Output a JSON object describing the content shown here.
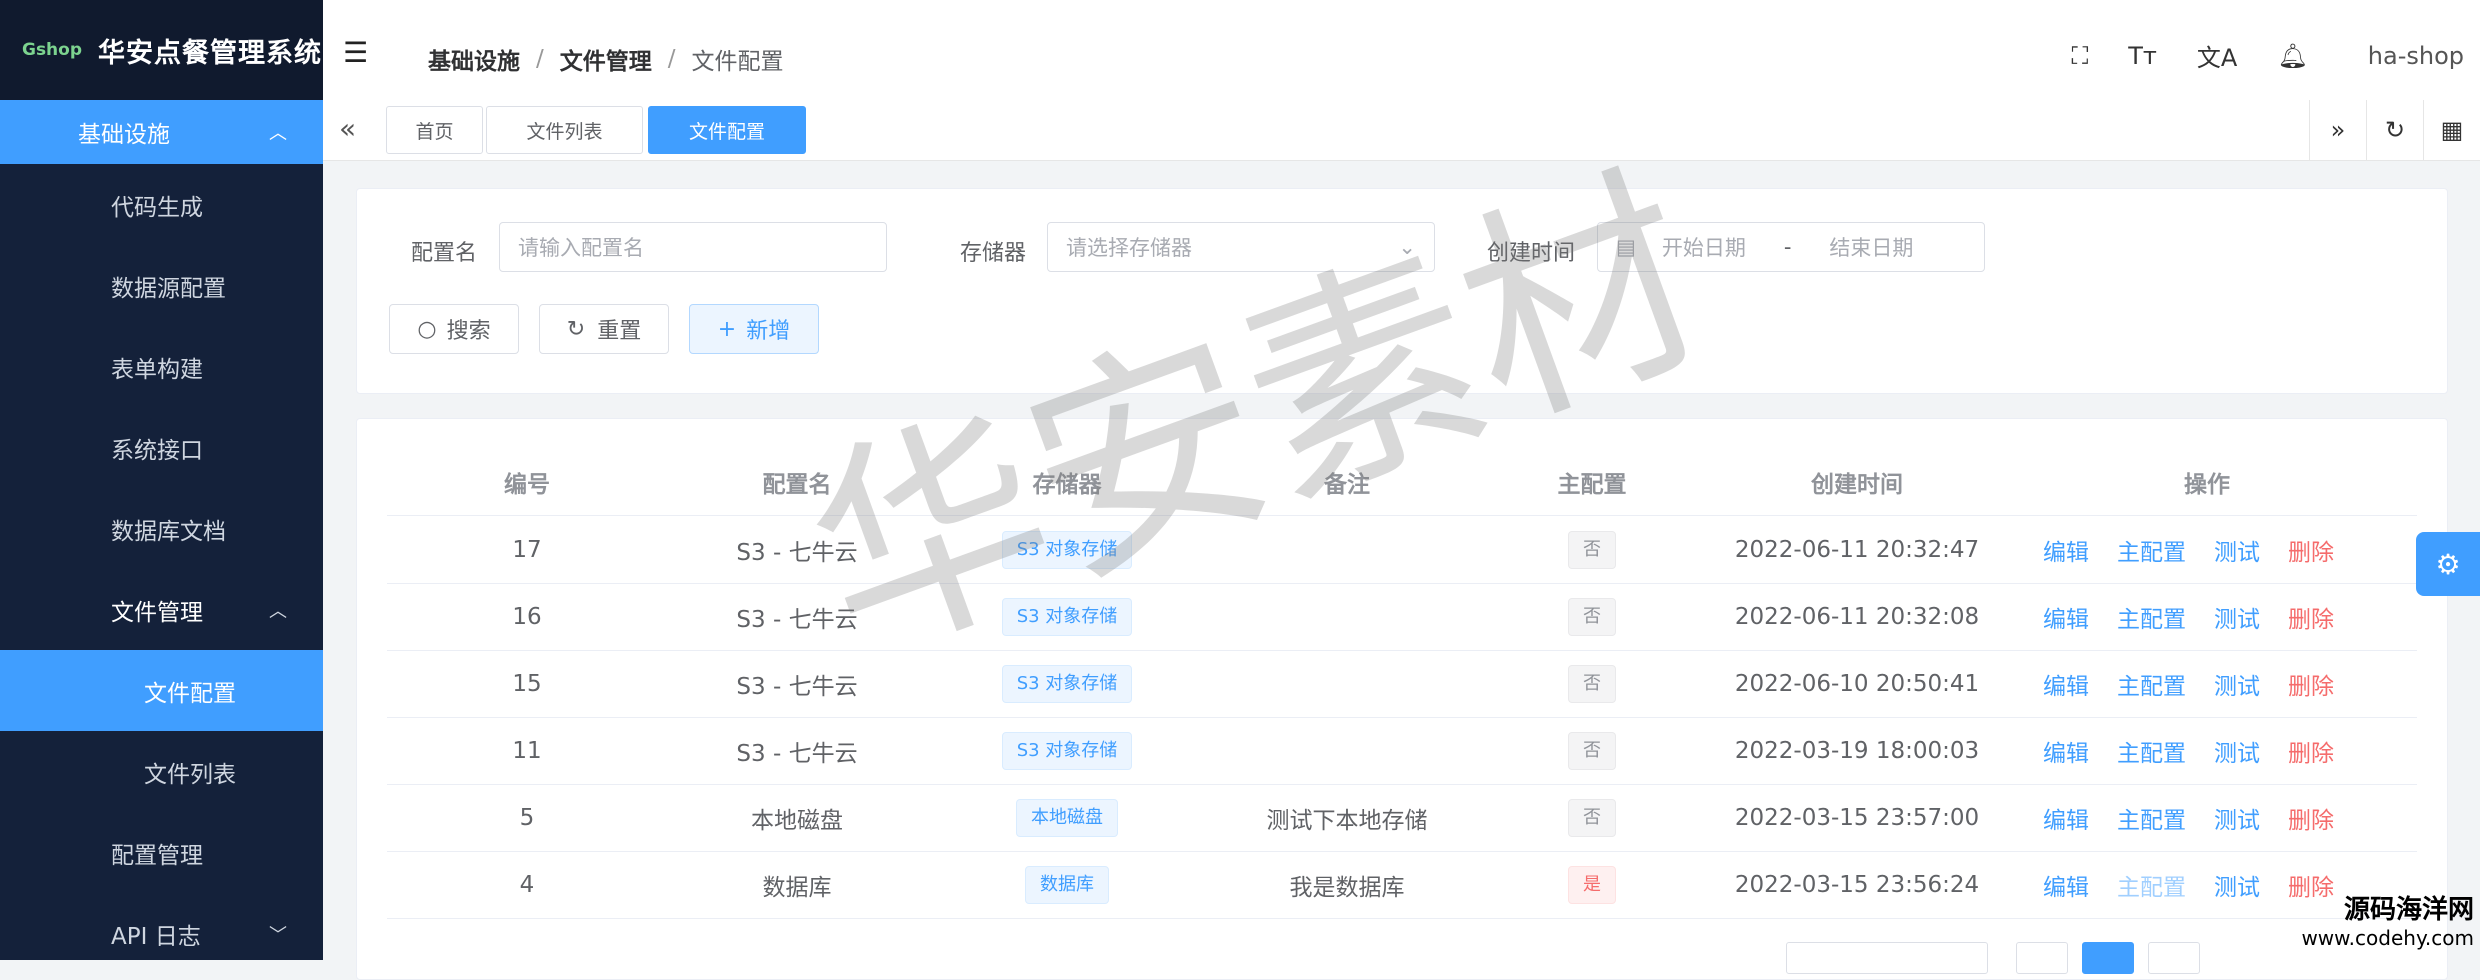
{
  "brand": {
    "logo": "Gshop",
    "title": "华安点餐管理系统"
  },
  "sidebar": {
    "top": "基础设施",
    "items": [
      "代码生成",
      "数据源配置",
      "表单构建",
      "系统接口",
      "数据库文档"
    ],
    "group": "文件管理",
    "subitems": [
      "文件配置",
      "文件列表"
    ],
    "after": [
      "配置管理",
      "API 日志"
    ]
  },
  "header": {
    "breadcrumb": [
      "基础设施",
      "文件管理",
      "文件配置"
    ],
    "sep": "/",
    "user": "ha-shop"
  },
  "tabs": [
    "首页",
    "文件列表",
    "文件配置"
  ],
  "search": {
    "name_label": "配置名",
    "name_placeholder": "请输入配置名",
    "storage_label": "存储器",
    "storage_placeholder": "请选择存储器",
    "time_label": "创建时间",
    "start_placeholder": "开始日期",
    "range_sep": "-",
    "end_placeholder": "结束日期",
    "btn_search": "搜索",
    "btn_reset": "重置",
    "btn_add": "新增"
  },
  "table": {
    "columns": [
      "编号",
      "配置名",
      "存储器",
      "备注",
      "主配置",
      "创建时间",
      "操作"
    ],
    "rows": [
      {
        "id": "17",
        "name": "S3 - 七牛云",
        "storage": "S3 对象存储",
        "remark": "",
        "master": "否",
        "time": "2022-06-11 20:32:47"
      },
      {
        "id": "16",
        "name": "S3 - 七牛云",
        "storage": "S3 对象存储",
        "remark": "",
        "master": "否",
        "time": "2022-06-11 20:32:08"
      },
      {
        "id": "15",
        "name": "S3 - 七牛云",
        "storage": "S3 对象存储",
        "remark": "",
        "master": "否",
        "time": "2022-06-10 20:50:41"
      },
      {
        "id": "11",
        "name": "S3 - 七牛云",
        "storage": "S3 对象存储",
        "remark": "",
        "master": "否",
        "time": "2022-03-19 18:00:03"
      },
      {
        "id": "5",
        "name": "本地磁盘",
        "storage": "本地磁盘",
        "remark": "测试下本地存储",
        "master": "否",
        "time": "2022-03-15 23:57:00"
      },
      {
        "id": "4",
        "name": "数据库",
        "storage": "数据库",
        "remark": "我是数据库",
        "master": "是",
        "time": "2022-03-15 23:56:24"
      }
    ],
    "ops": {
      "edit": "编辑",
      "master": "主配置",
      "test": "测试",
      "delete": "删除"
    }
  },
  "watermark": "华安素材",
  "corner": {
    "line1": "源码海洋网",
    "line2": "www.codehy.com"
  },
  "colors": {
    "primary": "#409eff",
    "sidebar": "#14213a",
    "danger": "#f56c6c"
  }
}
